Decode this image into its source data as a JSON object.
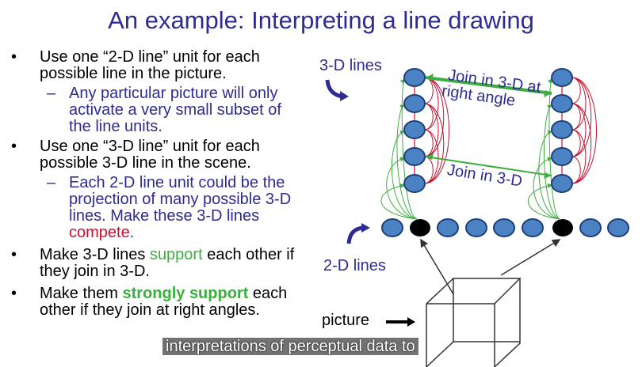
{
  "slide": {
    "title": "An example: Interpreting a line drawing",
    "bullets": {
      "b1": "Use one “2-D line” unit for each possible line in the picture.",
      "b1_sub": "Any particular picture will only activate a very small subset of the line units.",
      "b2": "Use one “3-D line” unit for each possible 3-D line in the scene.",
      "b2_sub_pre": "Each 2-D line unit could be the projection of many possible 3-D lines. Make these 3-D lines ",
      "b2_sub_red": "compete",
      "b2_sub_post": ".",
      "b3_pre": "Make 3-D lines ",
      "b3_green": "support",
      "b3_post": " each other if they join in 3-D.",
      "b4_pre": "Make them ",
      "b4_green": "strongly support",
      "b4_post": " each other if they join at right angles."
    },
    "bullet_symbol": "•",
    "dash_symbol": "–"
  },
  "diagram": {
    "label_3d": "3-D lines",
    "label_2d": "2-D lines",
    "label_join_right_1": "Join in 3-D at",
    "label_join_right_2": "right angle",
    "label_join_3d": "Join in 3-D",
    "label_picture": "picture"
  },
  "subtitle": "interpretations of perceptual data to",
  "colors": {
    "title": "#2e2b93",
    "node_fill": "#4a82c4",
    "node_active": "#000000",
    "compete": "#c8102e",
    "support": "#3cae3f"
  }
}
